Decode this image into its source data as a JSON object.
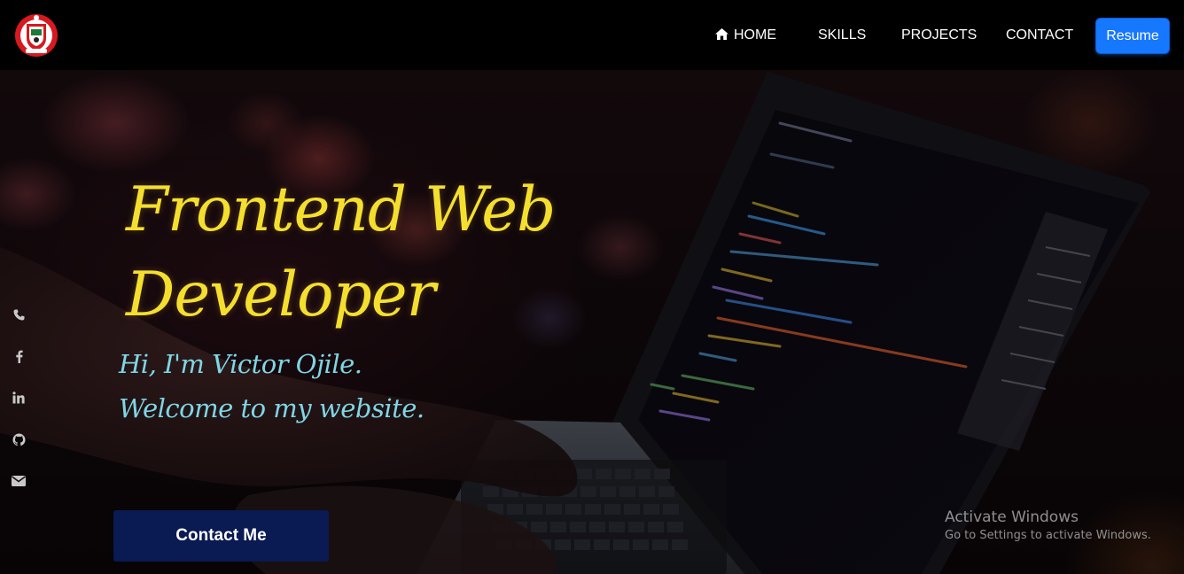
{
  "navbar": {
    "logo_icon": "football-club-crest-icon",
    "links": [
      {
        "label": "HOME",
        "icon": "home-icon"
      },
      {
        "label": "SKILLS"
      },
      {
        "label": "PROJECTS"
      },
      {
        "label": "CONTACT"
      }
    ],
    "resume_label": "Resume"
  },
  "hero": {
    "headline_line1": "Frontend Web",
    "headline_line2": "Developer",
    "greeting_line1": "Hi, I'm Victor Ojile.",
    "greeting_line2": "Welcome to my website.",
    "contact_label": "Contact Me",
    "background_image": "hands-typing-on-laptop-with-code-bokeh-icon"
  },
  "social_icons": [
    "phone-icon",
    "facebook-icon",
    "linkedin-icon",
    "github-icon",
    "envelope-icon"
  ],
  "watermark": {
    "title": "Activate Windows",
    "subtitle": "Go to Settings to activate Windows."
  },
  "colors": {
    "headline": "#f5df2e",
    "greeting": "#7fd6e6",
    "resume_button": "#1677ff",
    "contact_button": "#0a1a52",
    "navbar": "#000000"
  }
}
